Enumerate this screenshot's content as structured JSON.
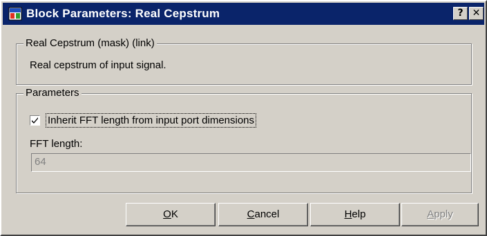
{
  "window": {
    "title": "Block Parameters: Real Cepstrum",
    "help_glyph": "?",
    "close_glyph": "✕",
    "icon": "simulink-block-icon"
  },
  "description_group": {
    "legend": "Real Cepstrum (mask) (link)",
    "text": "Real cepstrum of input signal."
  },
  "parameters_group": {
    "legend": "Parameters",
    "inherit_checkbox": {
      "label": "Inherit FFT length from input port dimensions",
      "checked": true
    },
    "fft_length": {
      "label": "FFT length:",
      "value": "64",
      "enabled": false
    }
  },
  "buttons": {
    "ok": {
      "mnemonic": "O",
      "rest": "K"
    },
    "cancel": {
      "mnemonic": "C",
      "rest": "ancel"
    },
    "help": {
      "mnemonic": "H",
      "rest": "elp"
    },
    "apply": {
      "mnemonic": "A",
      "rest": "pply",
      "enabled": false
    }
  },
  "colors": {
    "title_bar": "#0a246a",
    "dialog_face": "#d4d0c8",
    "disabled_text": "#808080"
  }
}
